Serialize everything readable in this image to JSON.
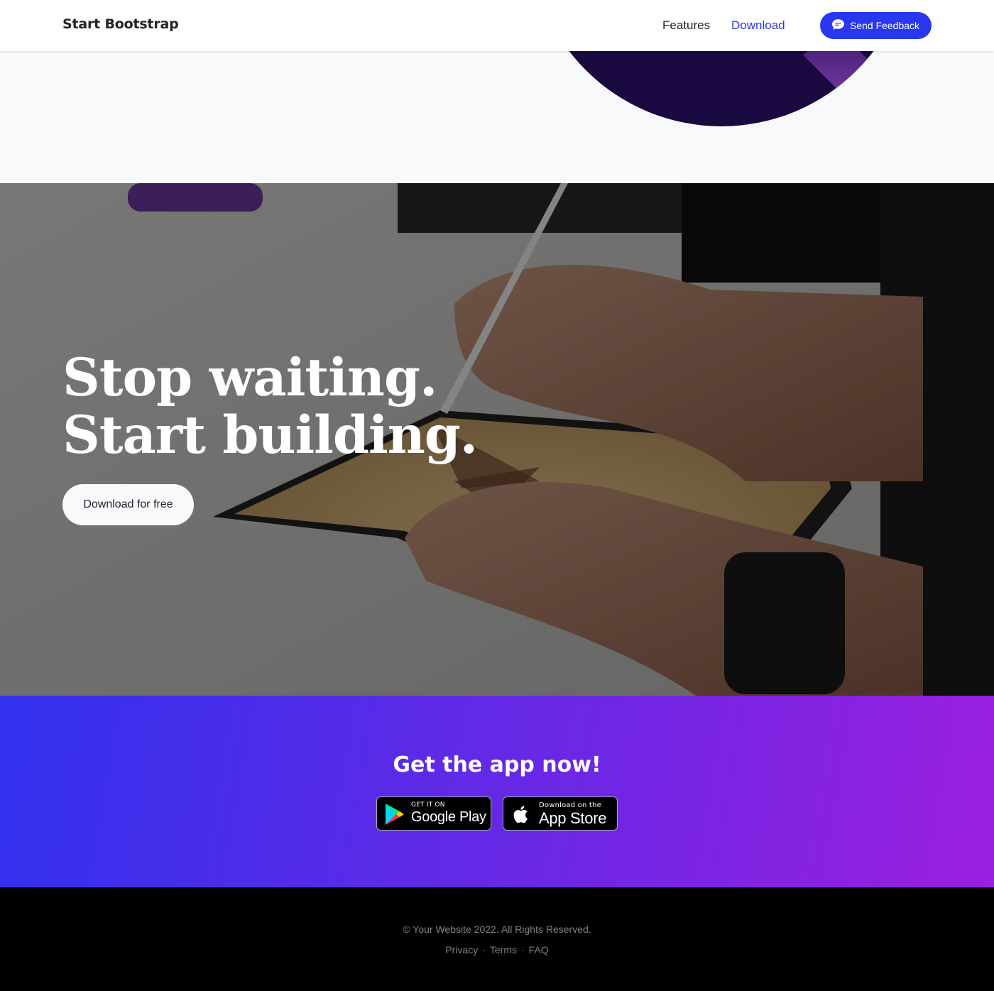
{
  "navbar": {
    "brand": "Start Bootstrap",
    "links": [
      {
        "label": "Features"
      },
      {
        "label": "Download"
      }
    ],
    "feedback_button": "Send Feedback",
    "active_color": "#2937f0"
  },
  "cta": {
    "heading_line1": "Stop waiting.",
    "heading_line2": "Start building.",
    "button": "Download for free"
  },
  "app_banner": {
    "title": "Get the app now!",
    "google_badge": {
      "small": "GET IT ON",
      "big": "Google Play"
    },
    "apple_badge": {
      "small": "Download on the",
      "big": "App Store"
    },
    "gradient": [
      "#3131ee",
      "#9b1fe0"
    ]
  },
  "footer": {
    "copyright": "© Your Website 2022. All Rights Reserved.",
    "links": [
      "Privacy",
      "Terms",
      "FAQ"
    ],
    "separator": "·"
  }
}
